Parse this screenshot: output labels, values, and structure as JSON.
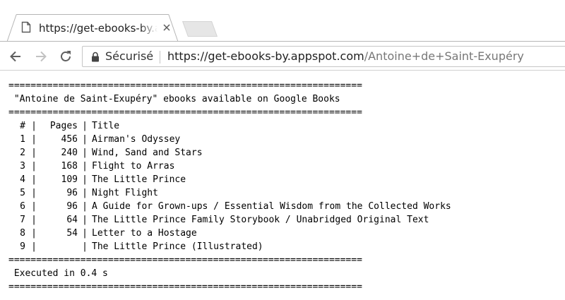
{
  "browser": {
    "tab": {
      "title": "https://get-ebooks-by.appspot.com/Antoine+de+Saint-Exupéry"
    },
    "toolbar": {
      "secure_label": "Sécurisé",
      "url_host": "https://get-ebooks-by.appspot.com",
      "url_path": "/Antoine+de+Saint-Exupéry"
    }
  },
  "page": {
    "separator": "================================================================",
    "heading": " \"Antoine de Saint-Exupéry\" ebooks available on Google Books",
    "columns": {
      "num": "#",
      "pages": "Pages",
      "title": "Title"
    },
    "books": [
      {
        "num": "1",
        "pages": "456",
        "title": "Airman's Odyssey"
      },
      {
        "num": "2",
        "pages": "240",
        "title": "Wind, Sand and Stars"
      },
      {
        "num": "3",
        "pages": "168",
        "title": "Flight to Arras"
      },
      {
        "num": "4",
        "pages": "109",
        "title": "The Little Prince"
      },
      {
        "num": "5",
        "pages": "96",
        "title": "Night Flight"
      },
      {
        "num": "6",
        "pages": "96",
        "title": "A Guide for Grown-ups / Essential Wisdom from the Collected Works"
      },
      {
        "num": "7",
        "pages": "64",
        "title": "The Little Prince Family Storybook / Unabridged Original Text"
      },
      {
        "num": "8",
        "pages": "54",
        "title": "Letter to a Hostage"
      },
      {
        "num": "9",
        "pages": "",
        "title": "The Little Prince (Illustrated)"
      }
    ],
    "footer": " Executed in 0.4 s"
  },
  "icons": {
    "back": "arrow-left-icon",
    "forward": "arrow-right-icon",
    "reload": "reload-icon",
    "lock": "lock-icon",
    "page": "page-icon",
    "close": "close-icon"
  },
  "colors": {
    "tab_border": "#b5b5b5",
    "url_path": "#777777",
    "text": "#000000"
  }
}
